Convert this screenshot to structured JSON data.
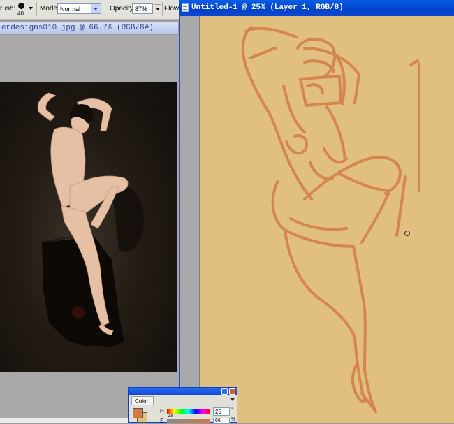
{
  "options_bar": {
    "brush_label": "rush:",
    "brush_size": "40",
    "mode_label": "Mode:",
    "mode_value": "Normal",
    "opacity_label": "Opacity:",
    "opacity_value": "87%",
    "flow_label": "Flow:"
  },
  "left_document": {
    "title": "erdesigns010.jpg @ 66.7% (RGB/8#)"
  },
  "right_document": {
    "title": "Untitled-1 @ 25% (Layer 1, RGB/8)"
  },
  "color_panel": {
    "tab_label": "Color",
    "h_label": "H",
    "h_value": "25",
    "h_unit": "°",
    "s_label": "S",
    "s_value": "66",
    "s_unit": "%",
    "foreground_color": "#d07a45",
    "background_color": "#e0bf7f"
  },
  "colors": {
    "canvas": "#e0bf7f",
    "sketch_stroke": "#d4804a",
    "title_bar_active": "#0142c8",
    "title_bar_inactive": "#b8c8ec"
  },
  "icons": [
    "brush-preset-icon",
    "dropdown-arrow-icon",
    "document-icon",
    "minimize-icon",
    "close-icon",
    "panel-menu-icon",
    "hue-slider-marker-icon"
  ]
}
